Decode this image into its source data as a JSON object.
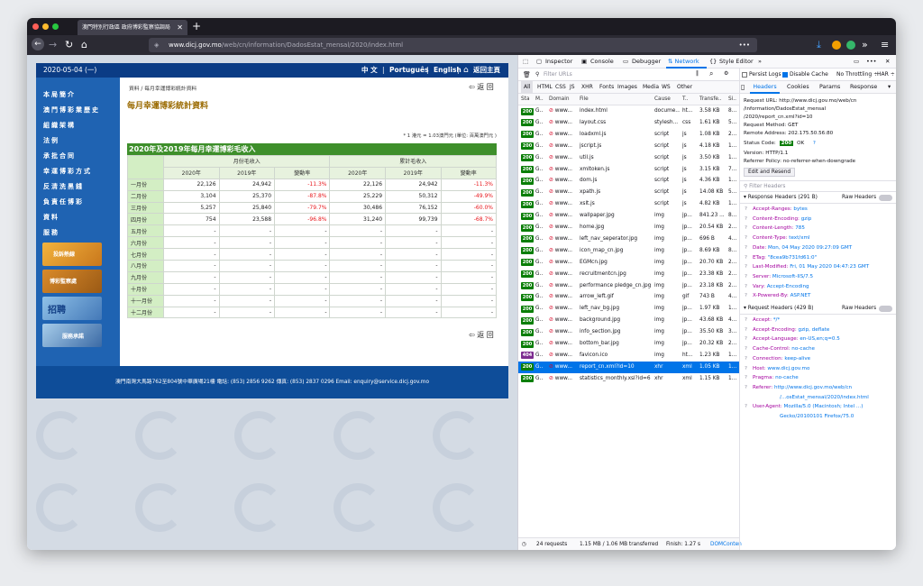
{
  "browser": {
    "tab_title": "澳門特別行政區 政府博彩監察協調局",
    "url_domain": "www.dicj.gov.mo",
    "url_path": "/web/cn/information/DadosEstat_mensal/2020/index.html",
    "close": "✕",
    "newtab": "+"
  },
  "site": {
    "date": "2020-05-04 (一)",
    "lang": [
      "中 文",
      "Português",
      "English"
    ],
    "home": "返回主頁",
    "nav": [
      "本局簡介",
      "澳門博彩業歷史",
      "組織架構",
      "法例",
      "承批合同",
      "幸運博彩方式",
      "反清洗黑錢",
      "負責任博彩",
      "資料",
      "服務"
    ],
    "breadcrumb": "資料 / 每月幸運博彩統計資料",
    "back": "返 回",
    "page_title": "每月幸運博彩統計資料",
    "note": "* 1 港元 = 1.03澳門元 (單位: 百萬澳門元 )",
    "table_title": "2020年及2019年每月幸運博彩毛收入",
    "group_headers": [
      "月份毛收入",
      "累計毛收入"
    ],
    "col_headers": [
      "2020年",
      "2019年",
      "變動率",
      "2020年",
      "2019年",
      "變動率"
    ],
    "rows": [
      [
        "一月份",
        "22,126",
        "24,942",
        "-11.3%",
        "22,126",
        "24,942",
        "-11.3%"
      ],
      [
        "二月份",
        "3,104",
        "25,370",
        "-87.8%",
        "25,229",
        "50,312",
        "-49.9%"
      ],
      [
        "三月份",
        "5,257",
        "25,840",
        "-79.7%",
        "30,486",
        "76,152",
        "-60.0%"
      ],
      [
        "四月份",
        "754",
        "23,588",
        "-96.8%",
        "31,240",
        "99,739",
        "-68.7%"
      ],
      [
        "五月份",
        "-",
        "-",
        "-",
        "-",
        "-",
        "-"
      ],
      [
        "六月份",
        "-",
        "-",
        "-",
        "-",
        "-",
        "-"
      ],
      [
        "七月份",
        "-",
        "-",
        "-",
        "-",
        "-",
        "-"
      ],
      [
        "八月份",
        "-",
        "-",
        "-",
        "-",
        "-",
        "-"
      ],
      [
        "九月份",
        "-",
        "-",
        "-",
        "-",
        "-",
        "-"
      ],
      [
        "十月份",
        "-",
        "-",
        "-",
        "-",
        "-",
        "-"
      ],
      [
        "十一月份",
        "-",
        "-",
        "-",
        "-",
        "-",
        "-"
      ],
      [
        "十二月份",
        "-",
        "-",
        "-",
        "-",
        "-",
        "-"
      ]
    ],
    "banners": [
      "投訴熱線",
      "博彩監察處",
      "招聘",
      "服務承諾"
    ],
    "footer": "澳門南灣大馬路762至804號中華廣場21樓   電話: (853) 2856 9262   傳真: (853) 2837 0296   Email: enquiry@service.dicj.gov.mo"
  },
  "devtools": {
    "tabs": [
      "Inspector",
      "Console",
      "Debugger",
      "Network",
      "Style Editor"
    ],
    "filter_placeholder": "Filter URLs",
    "persist": "Persist Logs",
    "disable_cache": "Disable Cache",
    "throttle": "No Throttling ÷",
    "har": "HAR ÷",
    "types": [
      "All",
      "HTML",
      "CSS",
      "JS",
      "XHR",
      "Fonts",
      "Images",
      "Media",
      "WS",
      "Other"
    ],
    "cols": [
      "Sta",
      "M..",
      "Domain",
      "File",
      "Cause",
      "T..",
      "Transfe..",
      "Si.."
    ],
    "requests": [
      [
        "200",
        "G..",
        "www...",
        "index.html",
        "docume...",
        "ht...",
        "3.58 KB",
        "8..."
      ],
      [
        "200",
        "G..",
        "www...",
        "layout.css",
        "stylesh...",
        "css",
        "1.61 KB",
        "5..."
      ],
      [
        "200",
        "G..",
        "www...",
        "loadxml.js",
        "script",
        "js",
        "1.08 KB",
        "2..."
      ],
      [
        "200",
        "G..",
        "www...",
        "jscript.js",
        "script",
        "js",
        "4.18 KB",
        "1..."
      ],
      [
        "200",
        "G..",
        "www...",
        "util.js",
        "script",
        "js",
        "3.50 KB",
        "1..."
      ],
      [
        "200",
        "G..",
        "www...",
        "xmltoken.js",
        "script",
        "js",
        "3.15 KB",
        "7..."
      ],
      [
        "200",
        "G..",
        "www...",
        "dom.js",
        "script",
        "js",
        "4.36 KB",
        "1..."
      ],
      [
        "200",
        "G..",
        "www...",
        "xpath.js",
        "script",
        "js",
        "14.08 KB",
        "5..."
      ],
      [
        "200",
        "G..",
        "www...",
        "xslt.js",
        "script",
        "js",
        "4.82 KB",
        "1..."
      ],
      [
        "200",
        "G..",
        "www...",
        "wallpaper.jpg",
        "img",
        "jp...",
        "841.23 ...",
        "8..."
      ],
      [
        "200",
        "G..",
        "www...",
        "home.jpg",
        "img",
        "jp...",
        "20.54 KB",
        "2..."
      ],
      [
        "200",
        "G..",
        "www...",
        "left_nav_seperator.jpg",
        "img",
        "jp...",
        "696 B",
        "4..."
      ],
      [
        "200",
        "G..",
        "www...",
        "icon_map_cn.jpg",
        "img",
        "jp...",
        "8.69 KB",
        "8..."
      ],
      [
        "200",
        "G..",
        "www...",
        "EGMcn.jpg",
        "img",
        "jp...",
        "20.70 KB",
        "2..."
      ],
      [
        "200",
        "G..",
        "www...",
        "recruitmentcn.jpg",
        "img",
        "jp...",
        "23.38 KB",
        "2..."
      ],
      [
        "200",
        "G..",
        "www...",
        "performance pledge_cn.jpg",
        "img",
        "jp...",
        "23.18 KB",
        "2..."
      ],
      [
        "200",
        "G..",
        "www...",
        "arrow_left.gif",
        "img",
        "gif",
        "743 B",
        "4..."
      ],
      [
        "200",
        "G..",
        "www...",
        "left_nav_bg.jpg",
        "img",
        "jp...",
        "1.97 KB",
        "1..."
      ],
      [
        "200",
        "G..",
        "www...",
        "background.jpg",
        "img",
        "jp...",
        "43.68 KB",
        "4..."
      ],
      [
        "200",
        "G..",
        "www...",
        "info_section.jpg",
        "img",
        "jp...",
        "35.50 KB",
        "3..."
      ],
      [
        "200",
        "G..",
        "www...",
        "bottom_bar.jpg",
        "img",
        "jp...",
        "20.32 KB",
        "2..."
      ],
      [
        "404",
        "G..",
        "www...",
        "favicon.ico",
        "img",
        "ht...",
        "1.23 KB",
        "1..."
      ],
      [
        "200",
        "G..",
        "www...",
        "report_cn.xml?id=10",
        "xhr",
        "xml",
        "1.05 KB",
        "1..."
      ],
      [
        "200",
        "G..",
        "www...",
        "statistics_monthly.xsl?id=6",
        "xhr",
        "xml",
        "1.15 KB",
        "1..."
      ]
    ],
    "summary": "24 requests",
    "transferred": "1.15 MB / 1.06 MB transferred",
    "finish": "Finish: 1.27 s",
    "domcontent": "DOMConten",
    "detail_tabs": [
      "Headers",
      "Cookies",
      "Params",
      "Response"
    ],
    "general": [
      "Request URL: http://www.dicj.gov.mo/web/cn",
      "/information/DadosEstat_mensal",
      "/2020/report_cn.xml?id=10",
      "Request Method: GET",
      "Remote Address: 202.175.50.56:80"
    ],
    "status_label": "Status Code:",
    "status_code": "200",
    "status_text": "OK",
    "version": "Version: HTTP/1.1",
    "referrer_policy": "Referrer Policy: no-referrer-when-downgrade",
    "edit_resend": "Edit and Resend",
    "filter_headers": "Filter Headers",
    "resp_title": "Response Headers (291 B)",
    "raw": "Raw Headers",
    "resp_headers": [
      [
        "Accept-Ranges:",
        "bytes"
      ],
      [
        "Content-Encoding:",
        "gzip"
      ],
      [
        "Content-Length:",
        "785"
      ],
      [
        "Content-Type:",
        "text/xml"
      ],
      [
        "Date:",
        "Mon, 04 May 2020 09:27:09 GMT"
      ],
      [
        "ETag:",
        "\"8cea9b731fd61:0\""
      ],
      [
        "Last-Modified:",
        "Fri, 01 May 2020 04:47:23 GMT"
      ],
      [
        "Server:",
        "Microsoft-IIS/7.5"
      ],
      [
        "Vary:",
        "Accept-Encoding"
      ],
      [
        "X-Powered-By:",
        "ASP.NET"
      ]
    ],
    "req_title": "Request Headers (429 B)",
    "req_headers": [
      [
        "Accept:",
        "*/*"
      ],
      [
        "Accept-Encoding:",
        "gzip, deflate"
      ],
      [
        "Accept-Language:",
        "en-US,en;q=0.5"
      ],
      [
        "Cache-Control:",
        "no-cache"
      ],
      [
        "Connection:",
        "keep-alive"
      ],
      [
        "Host:",
        "www.dicj.gov.mo"
      ],
      [
        "Pragma:",
        "no-cache"
      ],
      [
        "Referer:",
        "http://www.dicj.gov.mo/web/cn"
      ],
      [
        "",
        "/...osEstat_mensal/2020/index.html"
      ],
      [
        "User-Agent:",
        "Mozilla/5.0 (Macintosh; Intel ...)"
      ],
      [
        "",
        "Gecko/20100101 Firefox/75.0"
      ]
    ]
  }
}
